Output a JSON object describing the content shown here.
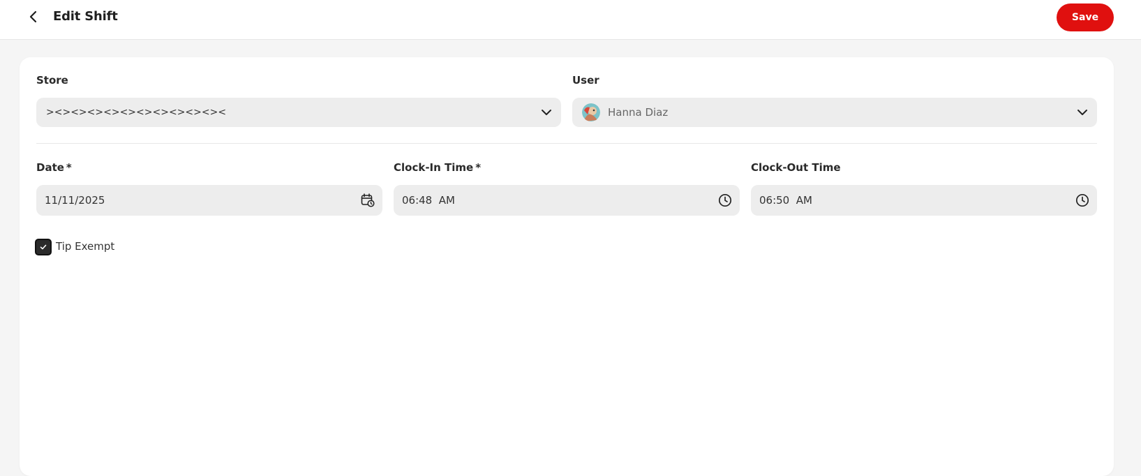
{
  "header": {
    "title": "Edit Shift",
    "save_label": "Save",
    "back_icon": "chevron-left-icon"
  },
  "form": {
    "store": {
      "label": "Store",
      "value": "><><><><><><><><><><><"
    },
    "user": {
      "label": "User",
      "value": "Hanna Diaz",
      "avatar": "avatar-illustration"
    },
    "date": {
      "label": "Date",
      "required_mark": "*",
      "value": "11/11/2025"
    },
    "clock_in": {
      "label": "Clock-In Time",
      "required_mark": "*",
      "value": "06:48  AM"
    },
    "clock_out": {
      "label": "Clock-Out Time",
      "value": "06:50  AM"
    },
    "tip_exempt": {
      "label": "Tip Exempt",
      "checked": true
    }
  },
  "colors": {
    "accent": "#e0100f",
    "field_bg": "#ededed",
    "page_bg": "#f5f5f5"
  }
}
